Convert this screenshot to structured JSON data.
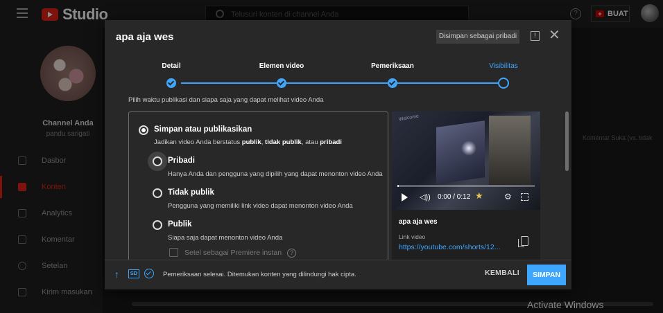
{
  "topbar": {
    "logo_text": "Studio",
    "search_placeholder": "Telusuri konten di channel Anda",
    "help_glyph": "?",
    "create_label": "BUAT",
    "create_glyph": "+"
  },
  "sidebar": {
    "channel_name": "Channel Anda",
    "channel_sub": "pandu sarigati",
    "items": [
      {
        "label": "Dasbor",
        "icon": "dashboard-icon",
        "active": false
      },
      {
        "label": "Konten",
        "icon": "content-icon",
        "active": true
      },
      {
        "label": "Analytics",
        "icon": "analytics-icon",
        "active": false
      },
      {
        "label": "Komentar",
        "icon": "comments-icon",
        "active": false
      },
      {
        "label": "Setelan",
        "icon": "settings-icon",
        "active": false
      },
      {
        "label": "Kirim masukan",
        "icon": "feedback-icon",
        "active": false
      }
    ]
  },
  "background": {
    "columns": "Komentar   Suka (vs. tidak",
    "watermark": "Activate Windows"
  },
  "dialog": {
    "title": "apa aja wes",
    "saved_badge": "Disimpan sebagai pribadi",
    "feedback_glyph": "!",
    "close_glyph": "✕",
    "steps": [
      {
        "label": "Detail",
        "done": true
      },
      {
        "label": "Elemen video",
        "done": true
      },
      {
        "label": "Pemeriksaan",
        "done": true
      },
      {
        "label": "Visibilitas",
        "current": true
      }
    ],
    "instruction": "Pilih waktu publikasi dan siapa saja yang dapat melihat video Anda",
    "save_or_publish": {
      "title": "Simpan atau publikasikan",
      "desc_prefix": "Jadikan video Anda berstatus ",
      "desc_publik": "publik",
      "desc_sep1": ", ",
      "desc_tidak_publik": "tidak publik",
      "desc_sep2": ", atau ",
      "desc_pribadi": "pribadi"
    },
    "options": [
      {
        "title": "Pribadi",
        "desc": "Hanya Anda dan pengguna yang dipilih yang dapat menonton video Anda"
      },
      {
        "title": "Tidak publik",
        "desc": "Pengguna yang memiliki link video dapat menonton video Anda"
      },
      {
        "title": "Publik",
        "desc": "Siapa saja dapat menonton video Anda"
      }
    ],
    "premiere_label": "Setel sebagai Premiere instan",
    "premiere_help_glyph": "?",
    "preview": {
      "video_text": "Welcome",
      "time": "0:00 / 0:12",
      "progress": 0.0,
      "title": "apa aja wes",
      "link_label": "Link video",
      "link": "https://youtube.com/shorts/12..."
    },
    "footer": {
      "upload_glyph": "↑",
      "sd_label": "SD",
      "status": "Pemeriksaan selesai. Ditemukan konten yang dilindungi hak cipta.",
      "back_label": "KEMBALI",
      "save_label": "SIMPAN"
    }
  },
  "colors": {
    "accent": "#3ea6ff",
    "brand_red": "#e62117",
    "dialog_bg": "#282828"
  }
}
